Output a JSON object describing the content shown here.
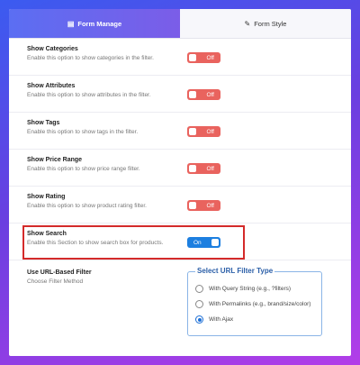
{
  "tabs": [
    {
      "label": "Form Manage",
      "icon": "form-icon",
      "active": true
    },
    {
      "label": "Form Style",
      "icon": "brush-icon",
      "active": false
    }
  ],
  "settings": [
    {
      "title": "Show Categories",
      "desc": "Enable this option to show categories in the filter.",
      "toggle": "Off"
    },
    {
      "title": "Show Attributes",
      "desc": "Enable this option to show attributes in the filter.",
      "toggle": "Off"
    },
    {
      "title": "Show Tags",
      "desc": "Enable this option to show tags in the filter.",
      "toggle": "Off"
    },
    {
      "title": "Show Price Range",
      "desc": "Enable this option to show price range filter.",
      "toggle": "Off"
    },
    {
      "title": "Show Rating",
      "desc": "Enable this option to show product rating filter.",
      "toggle": "Off"
    },
    {
      "title": "Show Search",
      "desc": "Enable this Section to show search box for products.",
      "toggle": "On"
    }
  ],
  "url_filter": {
    "title": "Use URL-Based Filter",
    "desc": "Choose Filter Method",
    "legend": "Select URL Filter Type",
    "options": [
      {
        "label": "With Query String (e.g., ?filters)",
        "checked": false
      },
      {
        "label": "With Permalinks (e.g., brand/size/color)",
        "checked": false
      },
      {
        "label": "With Ajax",
        "checked": true
      }
    ]
  },
  "colors": {
    "off": "#e9635e",
    "on": "#1d7fe0",
    "highlight": "#d42a2a",
    "tab_active": "#5b6ef2"
  }
}
